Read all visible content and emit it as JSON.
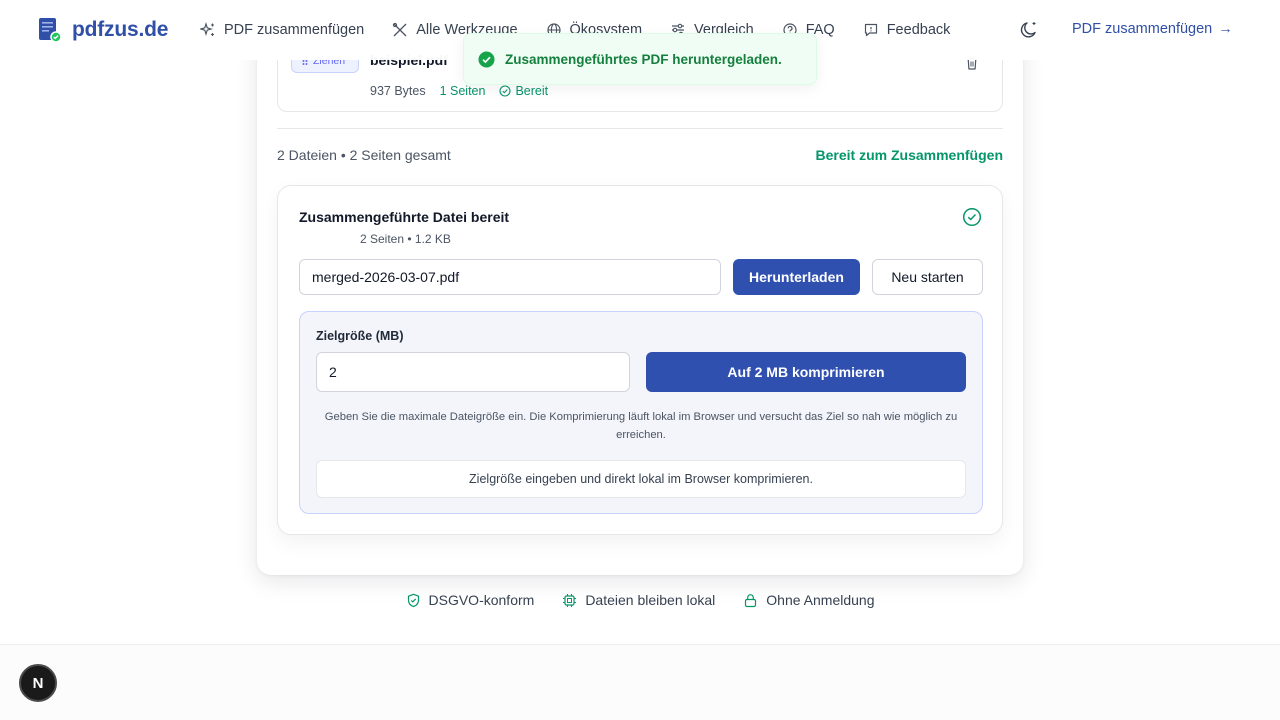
{
  "header": {
    "logo_text": "pdfzus.de",
    "nav": [
      {
        "label": "PDF zusammenfügen",
        "icon": "sparkles-icon"
      },
      {
        "label": "Alle Werkzeuge",
        "icon": "tools-icon"
      },
      {
        "label": "Ökosystem",
        "icon": "globe-icon"
      },
      {
        "label": "Vergleich",
        "icon": "sliders-icon"
      },
      {
        "label": "FAQ",
        "icon": "help-circle-icon"
      },
      {
        "label": "Feedback",
        "icon": "message-square-icon"
      }
    ],
    "cta_label": "PDF zusammenfügen",
    "cta_arrow": "→"
  },
  "toast": {
    "message": "Zusammengeführtes PDF heruntergeladen."
  },
  "file": {
    "drag_label": "Ziehen",
    "name": "beispiel.pdf",
    "size": "937 Bytes",
    "pages": "1 Seiten",
    "status": "Bereit"
  },
  "summary": {
    "text": "2 Dateien • 2 Seiten gesamt",
    "status": "Bereit zum Zusammenfügen"
  },
  "result": {
    "title": "Zusammengeführte Datei bereit",
    "meta": "2 Seiten • 1.2 KB",
    "filename_value": "merged-2026-03-07.pdf",
    "download_label": "Herunterladen",
    "restart_label": "Neu starten"
  },
  "compress": {
    "label": "Zielgröße (MB)",
    "value": "2",
    "button_label": "Auf 2 MB komprimieren",
    "help": "Geben Sie die maximale Dateigröße ein. Die Komprimierung läuft lokal im Browser und versucht das Ziel so nah wie möglich zu erreichen.",
    "status": "Zielgröße eingeben und direkt lokal im Browser komprimieren."
  },
  "badges": [
    {
      "label": "DSGVO-konform",
      "icon": "shield-check-icon"
    },
    {
      "label": "Dateien bleiben lokal",
      "icon": "chip-icon"
    },
    {
      "label": "Ohne Anmeldung",
      "icon": "lock-icon"
    }
  ],
  "next_badge": "N",
  "colors": {
    "brand": "#2f4fa8",
    "primary_button": "#3050b0",
    "success": "#059669",
    "toast_bg": "#f0fdf4"
  }
}
